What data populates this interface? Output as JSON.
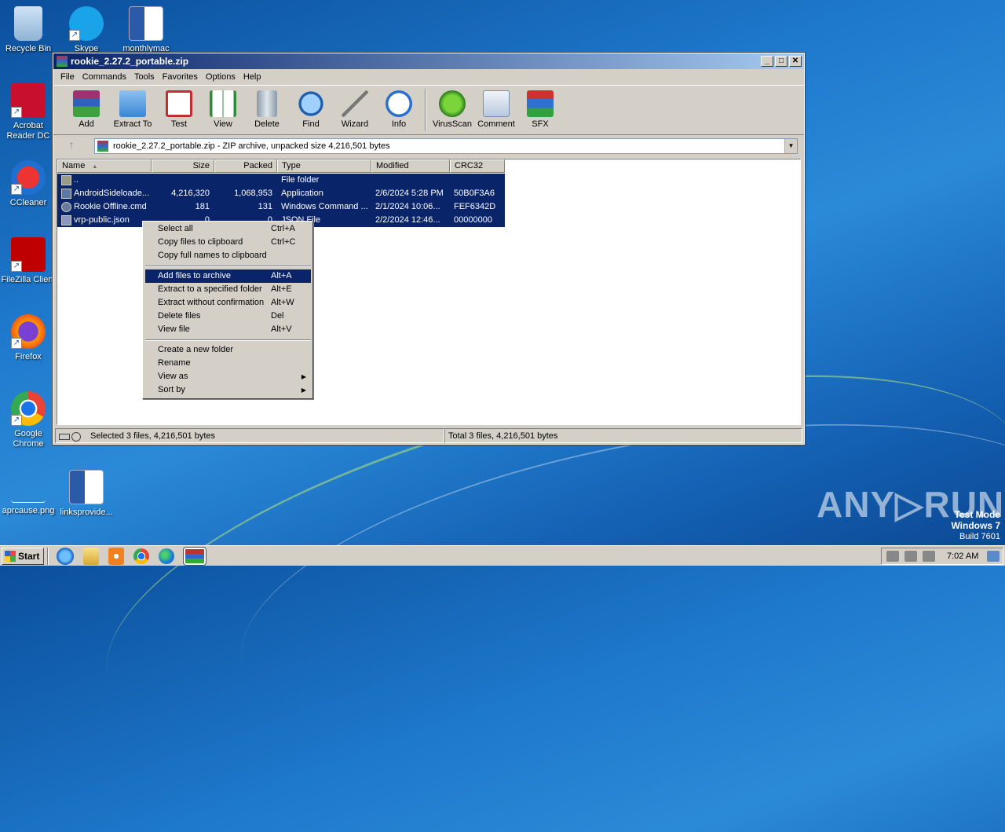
{
  "desktop": {
    "icons": [
      {
        "label": "Recycle Bin"
      },
      {
        "label": "Skype"
      },
      {
        "label": "monthlymac"
      },
      {
        "label": "Acrobat Reader DC"
      },
      {
        "label": "CCleaner"
      },
      {
        "label": "FileZilla Client"
      },
      {
        "label": "Firefox"
      },
      {
        "label": "Google Chrome"
      },
      {
        "label": "aprcause.png"
      },
      {
        "label": "linksprovide..."
      }
    ]
  },
  "window": {
    "title": "rookie_2.27.2_portable.zip",
    "controls": {
      "minimize": "_",
      "maximize": "□",
      "close": "✕"
    },
    "menu": [
      "File",
      "Commands",
      "Tools",
      "Favorites",
      "Options",
      "Help"
    ],
    "toolbar": [
      "Add",
      "Extract To",
      "Test",
      "View",
      "Delete",
      "Find",
      "Wizard",
      "Info",
      "VirusScan",
      "Comment",
      "SFX"
    ],
    "address": "rookie_2.27.2_portable.zip - ZIP archive, unpacked size 4,216,501 bytes",
    "columns": [
      "Name",
      "Size",
      "Packed",
      "Type",
      "Modified",
      "CRC32"
    ],
    "rows": [
      {
        "name": "..",
        "size": "",
        "packed": "",
        "type": "File folder",
        "modified": "",
        "crc": ""
      },
      {
        "name": "AndroidSideloade...",
        "size": "4,216,320",
        "packed": "1,068,953",
        "type": "Application",
        "modified": "2/6/2024 5:28 PM",
        "crc": "50B0F3A6"
      },
      {
        "name": "Rookie Offline.cmd",
        "size": "181",
        "packed": "131",
        "type": "Windows Command ...",
        "modified": "2/1/2024 10:06...",
        "crc": "FEF6342D"
      },
      {
        "name": "vrp-public.json",
        "size": "0",
        "packed": "0",
        "type": "JSON File",
        "modified": "2/2/2024 12:46...",
        "crc": "00000000"
      }
    ],
    "status_left": "Selected 3 files, 4,216,501 bytes",
    "status_right": "Total 3 files, 4,216,501 bytes"
  },
  "context_menu": {
    "groups": [
      [
        {
          "label": "Select all",
          "shortcut": "Ctrl+A"
        },
        {
          "label": "Copy files to clipboard",
          "shortcut": "Ctrl+C"
        },
        {
          "label": "Copy full names to clipboard",
          "shortcut": ""
        }
      ],
      [
        {
          "label": "Add files to archive",
          "shortcut": "Alt+A"
        },
        {
          "label": "Extract to a specified folder",
          "shortcut": "Alt+E"
        },
        {
          "label": "Extract without confirmation",
          "shortcut": "Alt+W"
        },
        {
          "label": "Delete files",
          "shortcut": "Del"
        },
        {
          "label": "View file",
          "shortcut": "Alt+V"
        }
      ],
      [
        {
          "label": "Create a new folder",
          "shortcut": ""
        },
        {
          "label": "Rename",
          "shortcut": ""
        },
        {
          "label": "View as",
          "shortcut": ""
        },
        {
          "label": "Sort by",
          "shortcut": ""
        }
      ]
    ],
    "submenu_arrow": "▶"
  },
  "taskbar": {
    "start_label": "Start",
    "clock": "7:02 AM"
  },
  "watermark": "ANY▷RUN",
  "test_mode": {
    "line1": "Test Mode",
    "line2": "Windows 7",
    "line3": "Build 7601"
  },
  "colors": {
    "selection": "#0a246a",
    "title_start": "#0a246a",
    "title_end": "#a6caf0",
    "chrome": "#d4d0c8"
  }
}
